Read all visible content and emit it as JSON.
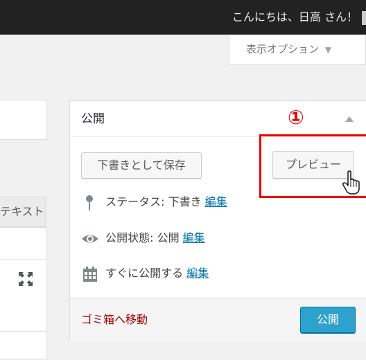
{
  "admin_bar": {
    "greeting": "こんにちは、日高 さん！"
  },
  "screen_options": {
    "label": "表示オプション",
    "arrow": "▼"
  },
  "editor": {
    "text_tab": "テキスト",
    "fullscreen_icon": "fullscreen-icon"
  },
  "publish_box": {
    "title": "公開",
    "annotation": "①",
    "save_draft_label": "下書きとして保存",
    "preview_label": "プレビュー",
    "status": {
      "label": "ステータス: 下書き",
      "edit": "編集",
      "icon": "pin-icon"
    },
    "visibility": {
      "label": "公開状態: 公開",
      "edit": "編集",
      "icon": "eye-icon"
    },
    "schedule": {
      "label": "すぐに公開する",
      "edit": "編集",
      "icon": "calendar-icon"
    },
    "trash_label": "ゴミ箱へ移動",
    "publish_label": "公開"
  },
  "colors": {
    "admin_bar": "#222222",
    "link": "#0073aa",
    "trash": "#aa0000",
    "primary_button": "#2ea2cc",
    "annotation": "#ee0000"
  }
}
